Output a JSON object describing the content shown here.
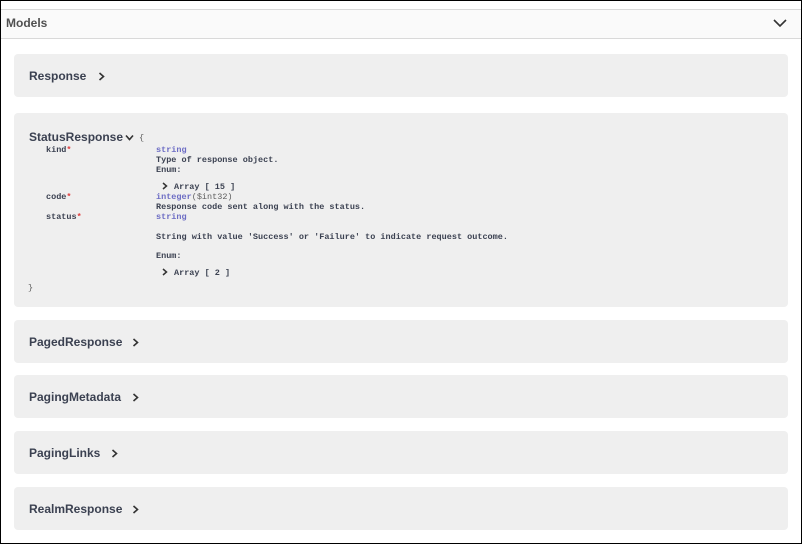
{
  "models": {
    "title": "Models"
  },
  "response": {
    "name": "Response"
  },
  "status_response": {
    "name": "StatusResponse",
    "open_brace": "{",
    "close_brace": "}",
    "properties": {
      "kind": {
        "name": "kind",
        "required_mark": "*",
        "type": "string",
        "description": "Type of response object.",
        "enum_label": "Enum:",
        "array_label": "Array [ 15 ]"
      },
      "code": {
        "name": "code",
        "required_mark": "*",
        "type": "integer",
        "format": "($int32)",
        "description": "Response code sent along with the status."
      },
      "status": {
        "name": "status",
        "required_mark": "*",
        "type": "string",
        "description": "String with value 'Success' or 'Failure' to indicate request outcome.",
        "enum_label": "Enum:",
        "array_label": "Array [ 2 ]"
      }
    }
  },
  "paged_response": {
    "name": "PagedResponse"
  },
  "paging_metadata": {
    "name": "PagingMetadata"
  },
  "paging_links": {
    "name": "PagingLinks"
  },
  "realm_response": {
    "name": "RealmResponse"
  }
}
